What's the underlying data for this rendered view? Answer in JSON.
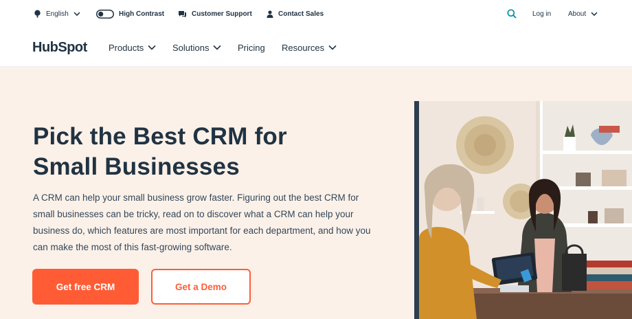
{
  "utility": {
    "language": "English",
    "high_contrast": "High Contrast",
    "customer_support": "Customer Support",
    "contact_sales": "Contact Sales",
    "login": "Log in",
    "about": "About"
  },
  "nav": {
    "logo": "HubSpot",
    "items": [
      {
        "label": "Products"
      },
      {
        "label": "Solutions"
      },
      {
        "label": "Pricing"
      },
      {
        "label": "Resources"
      }
    ]
  },
  "hero": {
    "title_line1": "Pick the Best CRM for",
    "title_line2": "Small Businesses",
    "body": "A CRM can help your small business grow faster. Figuring out the best CRM for small businesses can be tricky, read on to discover what a CRM can help your business do, which features are most important for each department, and how you can make the most of this fast-growing software.",
    "cta_primary": "Get free CRM",
    "cta_secondary": "Get a Demo"
  },
  "colors": {
    "brand_orange": "#ff5c35",
    "navy": "#213343",
    "hero_bg": "#fcf1e8"
  }
}
